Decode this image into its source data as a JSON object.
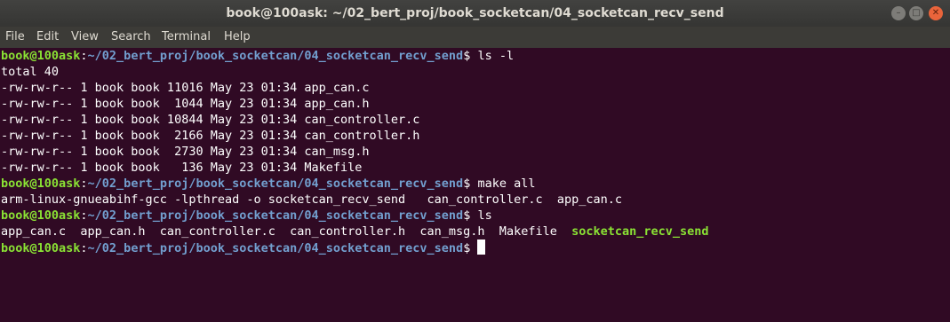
{
  "window": {
    "title": "book@100ask: ~/02_bert_proj/book_socketcan/04_socketcan_recv_send"
  },
  "menu": [
    "File",
    "Edit",
    "View",
    "Search",
    "Terminal",
    "Help"
  ],
  "prompt": {
    "user": "book@100ask",
    "path": "~/02_bert_proj/book_socketcan/04_socketcan_recv_send",
    "symbol": "$"
  },
  "session": [
    {
      "command": " ls -l",
      "output": [
        "total 40",
        "-rw-rw-r-- 1 book book 11016 May 23 01:34 app_can.c",
        "-rw-rw-r-- 1 book book  1044 May 23 01:34 app_can.h",
        "-rw-rw-r-- 1 book book 10844 May 23 01:34 can_controller.c",
        "-rw-rw-r-- 1 book book  2166 May 23 01:34 can_controller.h",
        "-rw-rw-r-- 1 book book  2730 May 23 01:34 can_msg.h",
        "-rw-rw-r-- 1 book book   136 May 23 01:34 Makefile"
      ]
    },
    {
      "command": " make all",
      "output": [
        "arm-linux-gnueabihf-gcc -lpthread -o socketcan_recv_send   can_controller.c  app_can.c"
      ]
    },
    {
      "command": " ls",
      "ls_output": {
        "files": "app_can.c  app_can.h  can_controller.c  can_controller.h  can_msg.h  Makefile  ",
        "executable": "socketcan_recv_send"
      }
    }
  ],
  "final_prompt": " "
}
